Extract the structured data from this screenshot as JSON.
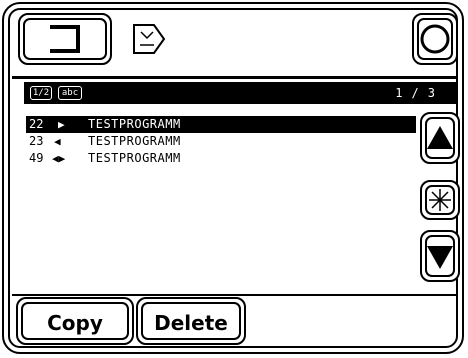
{
  "toolbar": {
    "exit_icon": "exit-bracket-icon",
    "program_icon": "program-select-icon",
    "stop_icon": "circle-icon"
  },
  "list_header": {
    "index_icon_text": "1/2",
    "sort_icon_text": "abc",
    "page_current": "1",
    "page_sep": "/",
    "page_total": "3"
  },
  "programs": [
    {
      "number": "22",
      "direction": "▶",
      "name": "TESTPROGRAMM",
      "selected": true
    },
    {
      "number": "23",
      "direction": "◀",
      "name": "TESTPROGRAMM",
      "selected": false
    },
    {
      "number": "49",
      "direction": "◀▶",
      "name": "TESTPROGRAMM",
      "selected": false
    }
  ],
  "side_buttons": {
    "up_icon": "triangle-up-icon",
    "star_icon": "asterisk-icon",
    "down_icon": "triangle-down-icon"
  },
  "softkeys": {
    "copy_label": "Copy",
    "delete_label": "Delete"
  }
}
